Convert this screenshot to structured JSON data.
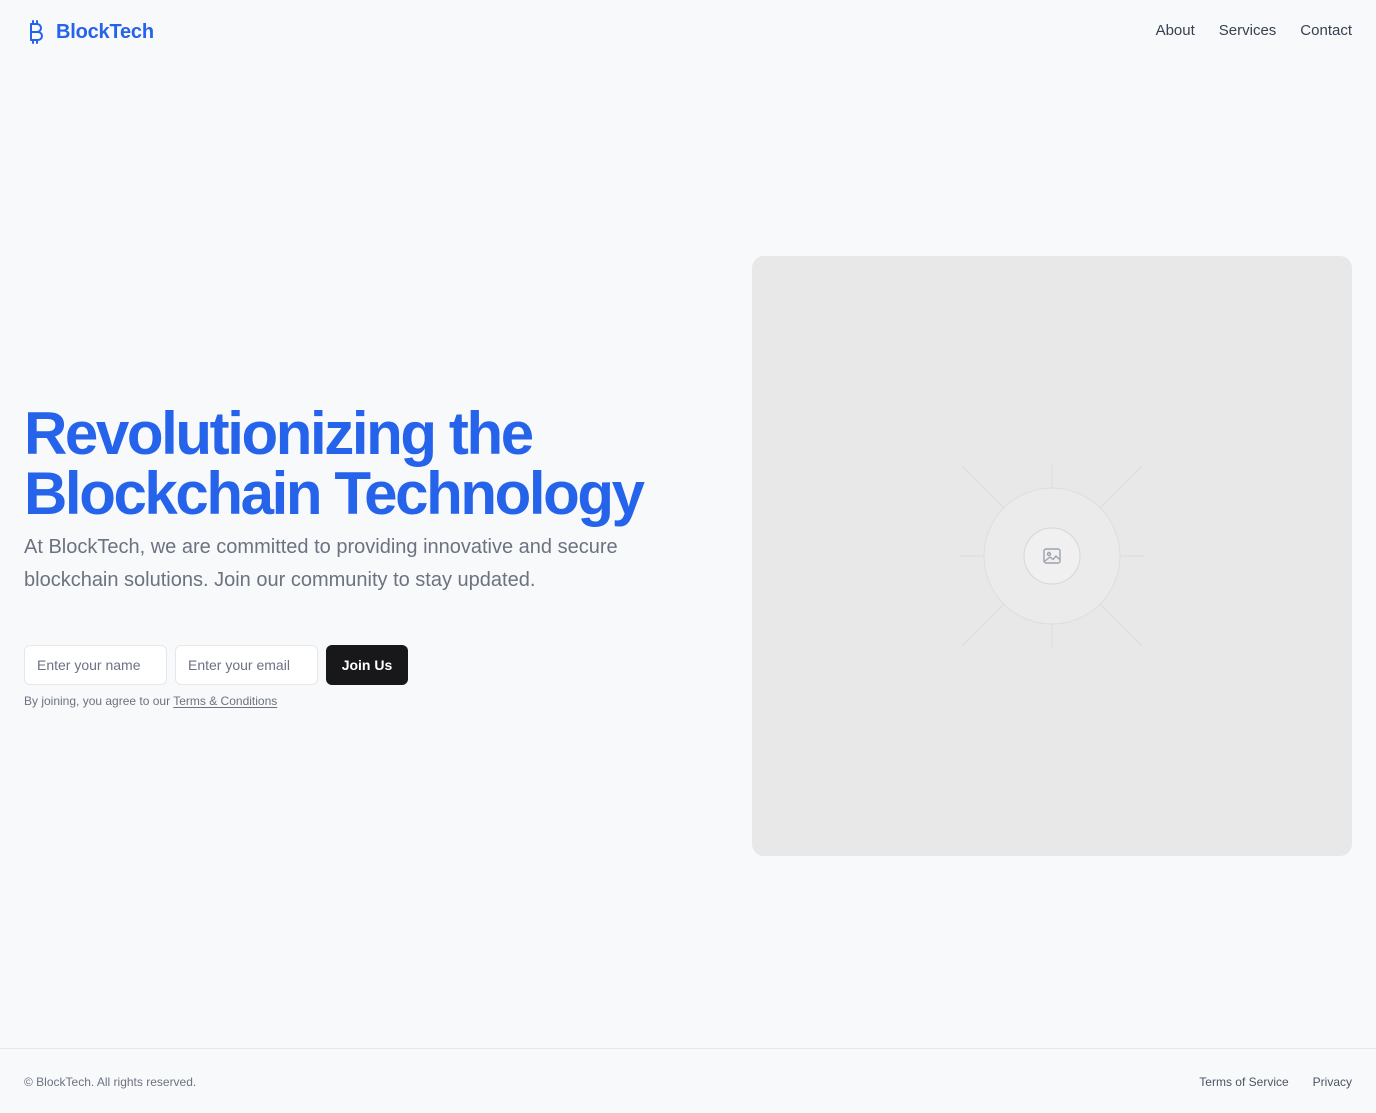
{
  "brand": {
    "name": "BlockTech",
    "icon": "bitcoin-icon",
    "color": "#2563eb"
  },
  "nav": {
    "items": [
      {
        "label": "About"
      },
      {
        "label": "Services"
      },
      {
        "label": "Contact"
      }
    ]
  },
  "hero": {
    "title_line1": "Revolutionizing the",
    "title_line2": "Blockchain Technology",
    "description": "At BlockTech, we are committed to providing innovative and secure blockchain solutions. Join our community to stay updated.",
    "name_placeholder": "Enter your name",
    "email_placeholder": "Enter your email",
    "join_label": "Join Us",
    "agree_text": "By joining, you agree to our",
    "terms_link": "Terms & Conditions",
    "image_icon": "image-placeholder-icon"
  },
  "footer": {
    "copyright": "© BlockTech. All rights reserved.",
    "links": [
      {
        "label": "Terms of Service"
      },
      {
        "label": "Privacy"
      }
    ]
  },
  "colors": {
    "accent": "#2563eb",
    "button_bg": "#18181b",
    "page_bg": "#f8f9fb",
    "placeholder_bg": "#e8e8e8"
  }
}
